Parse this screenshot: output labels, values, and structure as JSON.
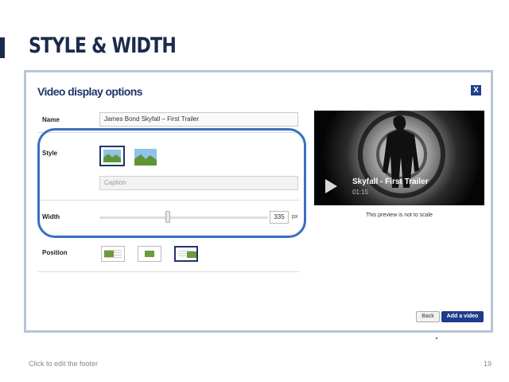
{
  "slide": {
    "title": "STYLE & WIDTH",
    "footer": "Click to edit the footer",
    "page_number": "19"
  },
  "dialog": {
    "title": "Video display options",
    "close": "X",
    "name": {
      "label": "Name",
      "value": "James Bond Skyfall – First Trailer"
    },
    "style": {
      "label": "Style",
      "caption_placeholder": "Caption",
      "selected_index": 0
    },
    "width": {
      "label": "Width",
      "value": "335",
      "unit": "px",
      "slider_fraction": 0.42
    },
    "position": {
      "label": "Position",
      "options": [
        "left",
        "center",
        "right"
      ],
      "selected_index": 2
    },
    "preview": {
      "video_title": "Skyfall - First Trailer",
      "duration": "01:15",
      "note": "This preview is not to scale"
    },
    "buttons": {
      "back": "Back",
      "add": "Add a video"
    }
  },
  "colors": {
    "navy": "#1b2a4e",
    "accent_blue": "#1e3d8a",
    "highlight": "#3a6fc4",
    "thumbnail_green": "#6a9a3c"
  }
}
